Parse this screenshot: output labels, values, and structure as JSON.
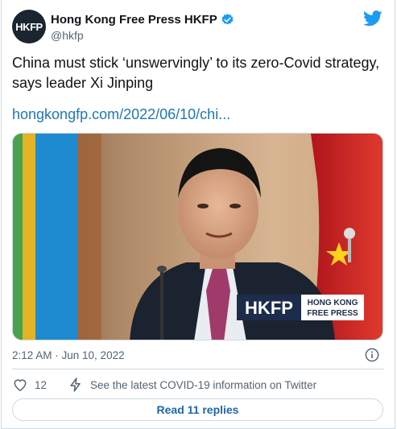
{
  "tweet": {
    "author": {
      "avatar_text": "HKFP",
      "display_name": "Hong Kong Free Press HKFP",
      "handle": "@hkfp",
      "verified": true
    },
    "text": "China must stick ‘unswervingly’ to its zero-Covid strategy, says leader Xi Jinping",
    "link": "hongkongfp.com/2022/06/10/chi...",
    "media": {
      "watermark_logo": "HKFP",
      "watermark_line1": "HONG KONG",
      "watermark_line2": "FREE PRESS"
    },
    "timestamp": "2:12 AM · Jun 10, 2022",
    "likes": "12",
    "covid_notice": "See the latest COVID-19 information on Twitter",
    "read_replies": "Read 11 replies"
  },
  "colors": {
    "accent": "#1d9bf0",
    "link": "#1d77b7",
    "muted": "#536471",
    "border": "#cfd9de"
  },
  "icons": [
    "twitter-logo-icon",
    "verified-badge-icon",
    "info-icon",
    "heart-icon",
    "lightning-icon"
  ]
}
